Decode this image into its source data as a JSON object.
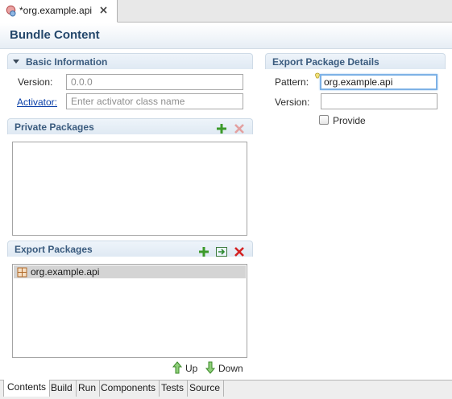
{
  "editor_tab": {
    "title": "*org.example.api",
    "icon": "bundle-manifest-icon"
  },
  "form": {
    "title": "Bundle Content"
  },
  "basic_info": {
    "title": "Basic Information",
    "version_label": "Version:",
    "version_placeholder": "0.0.0",
    "activator_label": "Activator:",
    "activator_placeholder": "Enter activator class name"
  },
  "private_packages": {
    "title": "Private Packages",
    "items": []
  },
  "export_packages": {
    "title": "Export Packages",
    "items": [
      {
        "label": "org.example.api",
        "selected": true
      }
    ],
    "up_label": "Up",
    "down_label": "Down"
  },
  "export_details": {
    "title": "Export Package Details",
    "pattern_label": "Pattern:",
    "pattern_value": "org.example.api",
    "version_label": "Version:",
    "version_value": "",
    "provide_label": "Provide",
    "provide_checked": false
  },
  "page_tabs": [
    {
      "label": "Contents",
      "active": true
    },
    {
      "label": "Build",
      "active": false
    },
    {
      "label": "Run",
      "active": false
    },
    {
      "label": "Components",
      "active": false
    },
    {
      "label": "Tests",
      "active": false
    },
    {
      "label": "Source",
      "active": false
    }
  ],
  "colors": {
    "add": "#3c9a2a",
    "remove": "#d42222",
    "header_text": "#24476b",
    "section_text": "#3a5b7e"
  }
}
